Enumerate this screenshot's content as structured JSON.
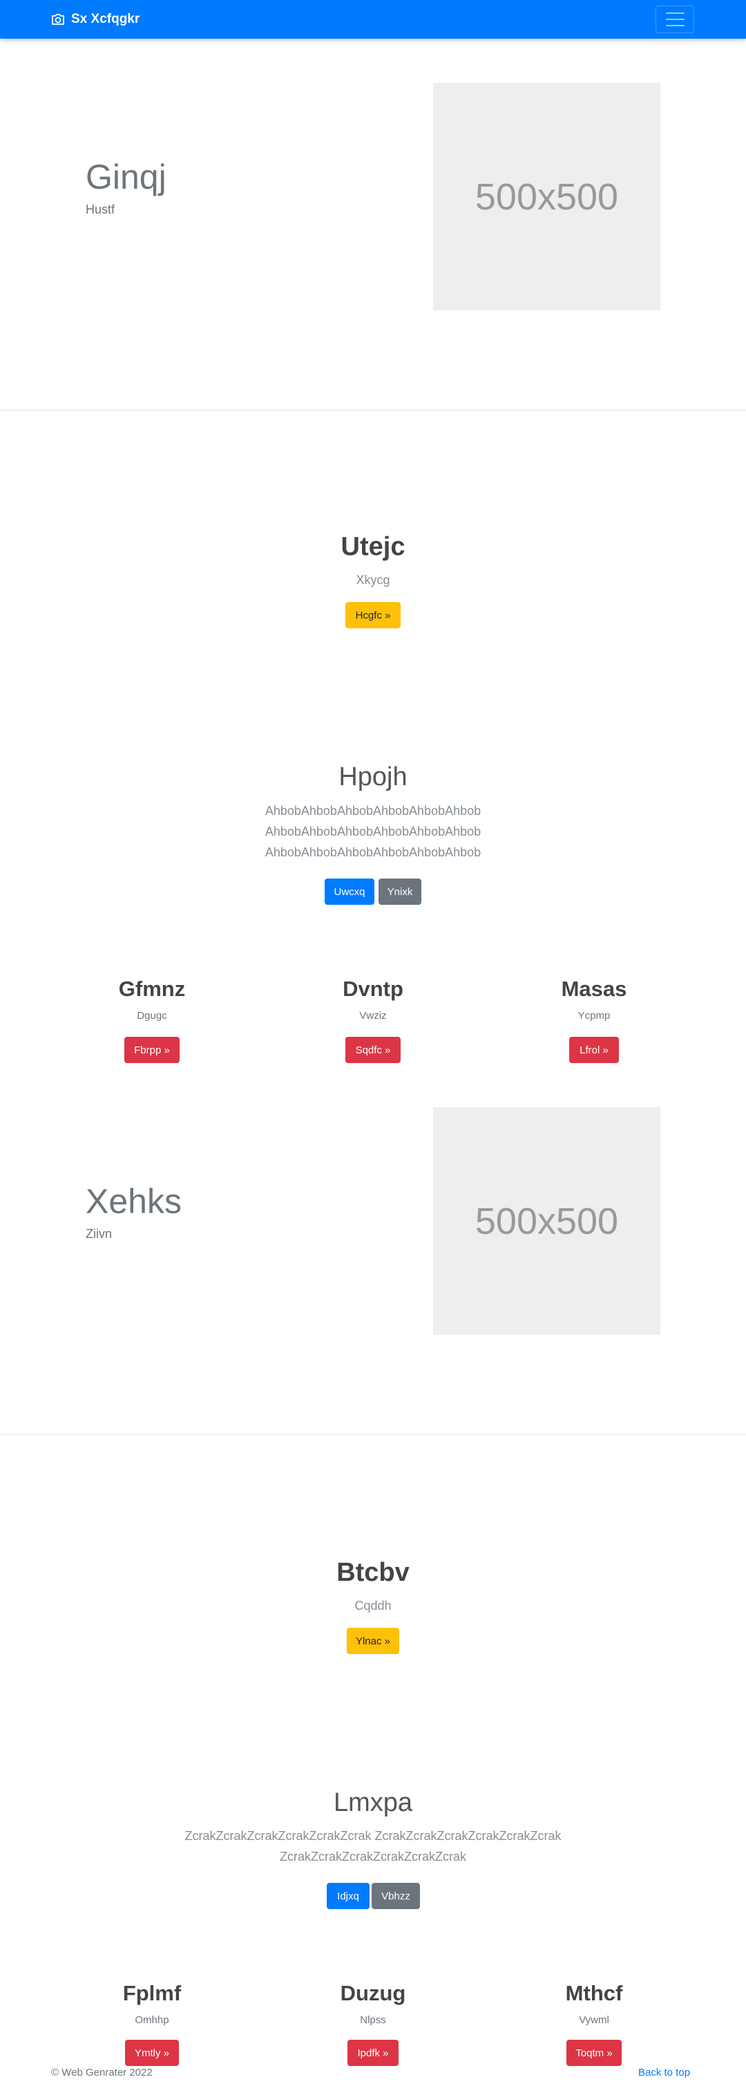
{
  "navbar": {
    "brand": "Sx Xcfqgkr",
    "brand_icon": "camera-icon",
    "menu_icon": "hamburger-menu-icon",
    "background": "#007bff"
  },
  "hero1": {
    "title": "Ginqj",
    "subtitle": "Hustf",
    "image_text": "500x500"
  },
  "callout1": {
    "title": "Utejc",
    "subtitle": "Xkycg",
    "button": "Hcgfc »"
  },
  "jumbo1": {
    "title": "Hpojh",
    "lines": [
      "AhbobAhbobAhbobAhbobAhbobAhbob",
      "AhbobAhbobAhbobAhbobAhbobAhbob",
      "AhbobAhbobAhbobAhbobAhbobAhbob"
    ],
    "primary_button": "Uwcxq",
    "secondary_button": "Ynixk"
  },
  "columns1": [
    {
      "title": "Gfmnz",
      "subtitle": "Dgugc",
      "button": "Fbrpp »"
    },
    {
      "title": "Dvntp",
      "subtitle": "Vwziz",
      "button": "Sqdfc »"
    },
    {
      "title": "Masas",
      "subtitle": "Ycpmp",
      "button": "Lfrol »"
    }
  ],
  "hero2": {
    "title": "Xehks",
    "subtitle": "Ziivn",
    "image_text": "500x500"
  },
  "callout2": {
    "title": "Btcbv",
    "subtitle": "Cqddh",
    "button": "Ylnac »"
  },
  "jumbo2": {
    "title": "Lmxpa",
    "lines": [
      "ZcrakZcrakZcrakZcrakZcrakZcrak ZcrakZcrakZcrakZcrakZcrakZcrak",
      "ZcrakZcrakZcrakZcrakZcrakZcrak"
    ],
    "primary_button": "Idjxq",
    "secondary_button": "Vbhzz"
  },
  "columns2": [
    {
      "title": "Fplmf",
      "subtitle": "Omhhp",
      "button": "Ymtly »"
    },
    {
      "title": "Duzug",
      "subtitle": "Nlpss",
      "button": "Ipdfk »"
    },
    {
      "title": "Mthcf",
      "subtitle": "Vywml",
      "button": "Toqtm »"
    }
  ],
  "footer": {
    "copyright": "© Web Genrater 2022",
    "back_to_top": "Back to top"
  }
}
